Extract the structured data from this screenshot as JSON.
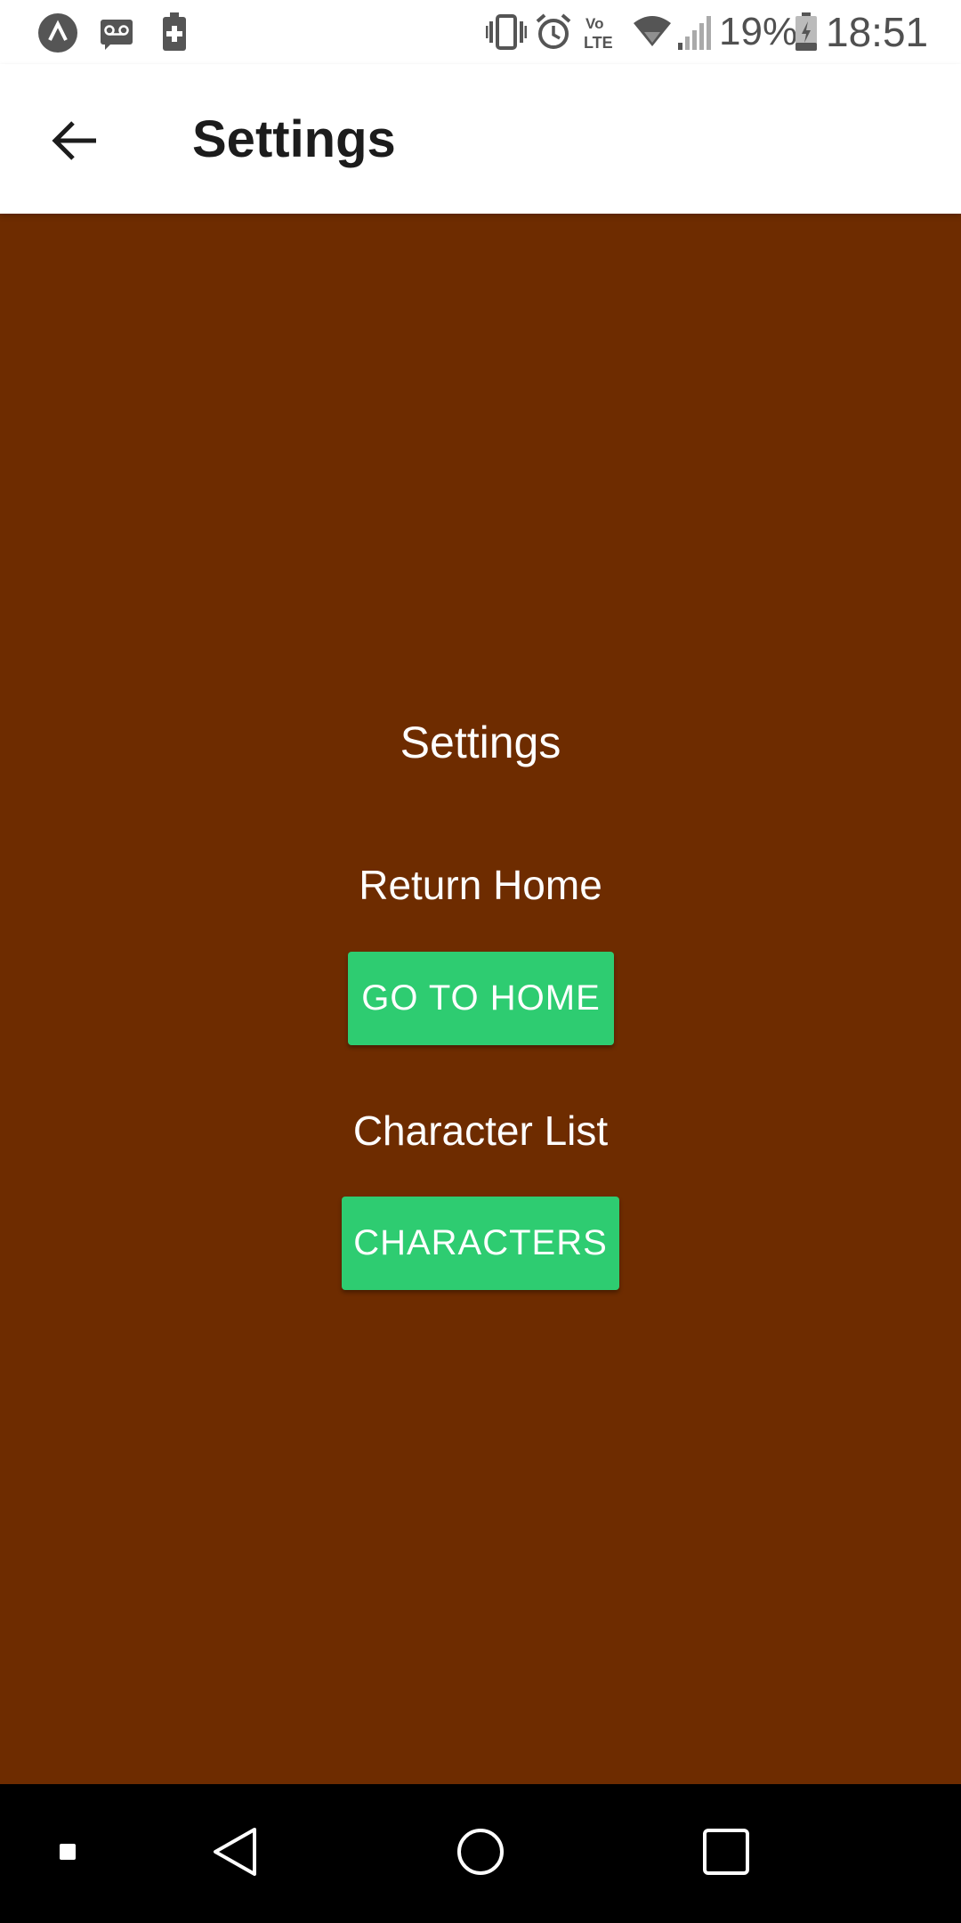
{
  "status_bar": {
    "battery_percent": "19%",
    "time": "18:51",
    "icons": [
      "app-icon",
      "voicemail-icon",
      "battery-saver-icon",
      "vibrate-icon",
      "alarm-icon",
      "volte-icon",
      "wifi-icon",
      "signal-icon",
      "battery-icon"
    ]
  },
  "app_bar": {
    "title": "Settings",
    "back_icon": "arrow-back-icon"
  },
  "main": {
    "heading": "Settings",
    "return_home_label": "Return Home",
    "go_home_button": "GO TO HOME",
    "character_list_label": "Character List",
    "characters_button": "CHARACTERS"
  },
  "nav_bar": {
    "icons": [
      "menu-dot-icon",
      "back-triangle-icon",
      "home-circle-icon",
      "recents-square-icon"
    ]
  },
  "colors": {
    "background": "#6e2c00",
    "button": "#2ecc71",
    "app_bar": "#ffffff",
    "nav_bar": "#000000"
  }
}
